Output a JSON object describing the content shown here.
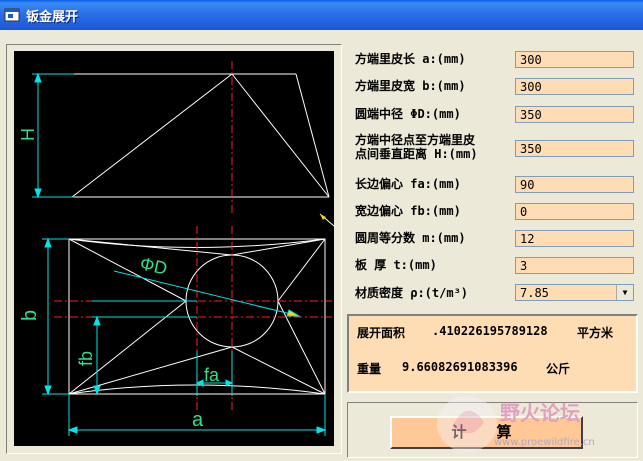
{
  "window": {
    "title": "钣金展开"
  },
  "fields": [
    {
      "label": "方端里皮长 a:(mm)",
      "value": "300"
    },
    {
      "label": "方端里皮宽 b:(mm)",
      "value": "300"
    },
    {
      "label": "圆端中径 ΦD:(mm)",
      "value": "350"
    },
    {
      "label_line1": "方端中径点至方端里皮",
      "label_line2": "点间垂直距离 H:(mm)",
      "value": "350"
    },
    {
      "label": "长边偏心 fa:(mm)",
      "value": "90"
    },
    {
      "label": "宽边偏心 fb:(mm)",
      "value": "0"
    },
    {
      "label": "圆周等分数 m:(mm)",
      "value": "12"
    },
    {
      "label": "板   厚 t:(mm)",
      "value": "3"
    },
    {
      "label": "材质密度 ρ:(t/m³)",
      "value": "7.85",
      "type": "select"
    }
  ],
  "result": {
    "area_label": "展开面积",
    "area_value": ".410226195789128",
    "area_unit": "平方米",
    "weight_label": "重量",
    "weight_value": "9.66082691083396",
    "weight_unit": "公斤"
  },
  "calc_button": "计算",
  "drawing_labels": {
    "H": "H",
    "D": "ΦD",
    "b": "b",
    "fb": "fb",
    "fa": "fa",
    "a": "a"
  },
  "watermark": {
    "text": "野火论坛",
    "url": "www.proewildfire.cn"
  },
  "colors": {
    "drawing_bg": "#000000",
    "input_bg": "#FFDDB4",
    "dim_cyan": "#00E5E5",
    "centerline_red": "#FF2020"
  }
}
